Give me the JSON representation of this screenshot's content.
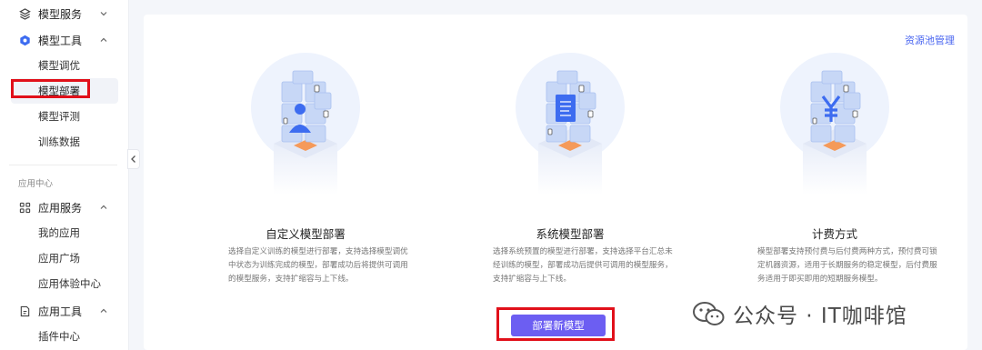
{
  "sidebar": {
    "groups": [
      {
        "label": "模型服务",
        "icon": "cube-stack-icon",
        "expanded": false
      },
      {
        "label": "模型工具",
        "icon": "hexagon-icon",
        "expanded": true
      },
      {
        "label": "应用服务",
        "icon": "grid-apps-icon",
        "expanded": true
      },
      {
        "label": "应用工具",
        "icon": "document-tool-icon",
        "expanded": true
      }
    ],
    "model_tools_items": [
      "模型调优",
      "模型部署",
      "模型评测",
      "训练数据"
    ],
    "section_label": "应用中心",
    "app_service_items": [
      "我的应用",
      "应用广场",
      "应用体验中心"
    ],
    "app_tools_items": [
      "插件中心"
    ],
    "active_item": "模型部署",
    "accent_color": "#3d6cf0"
  },
  "main": {
    "top_link": "资源池管理",
    "cards": [
      {
        "title": "自定义模型部署",
        "description": "选择自定义训练的模型进行部署，支持选择模型调优中状态为训练完成的模型，部署成功后将提供可调用的模型服务，支持扩缩容与上下线。",
        "icon": "user-cube-icon"
      },
      {
        "title": "系统模型部署",
        "description": "选择系统预置的模型进行部署，支持选择平台汇总未经训练的模型，部署成功后提供可调用的模型服务，支持扩缩容与上下线。",
        "icon": "document-cube-icon"
      },
      {
        "title": "计费方式",
        "description": "模型部署支持预付费与后付费两种方式，预付费可锁定机器资源，适用于长期服务的稳定模型，后付费服务适用于即买即用的短期服务模型。",
        "icon": "yuan-cube-icon"
      }
    ],
    "deploy_button": "部署新模型",
    "button_color": "#6c5ef2"
  },
  "watermark": {
    "text": "公众号 · IT咖啡馆",
    "icon": "wechat-icon"
  },
  "highlight_color": "#e1101a"
}
